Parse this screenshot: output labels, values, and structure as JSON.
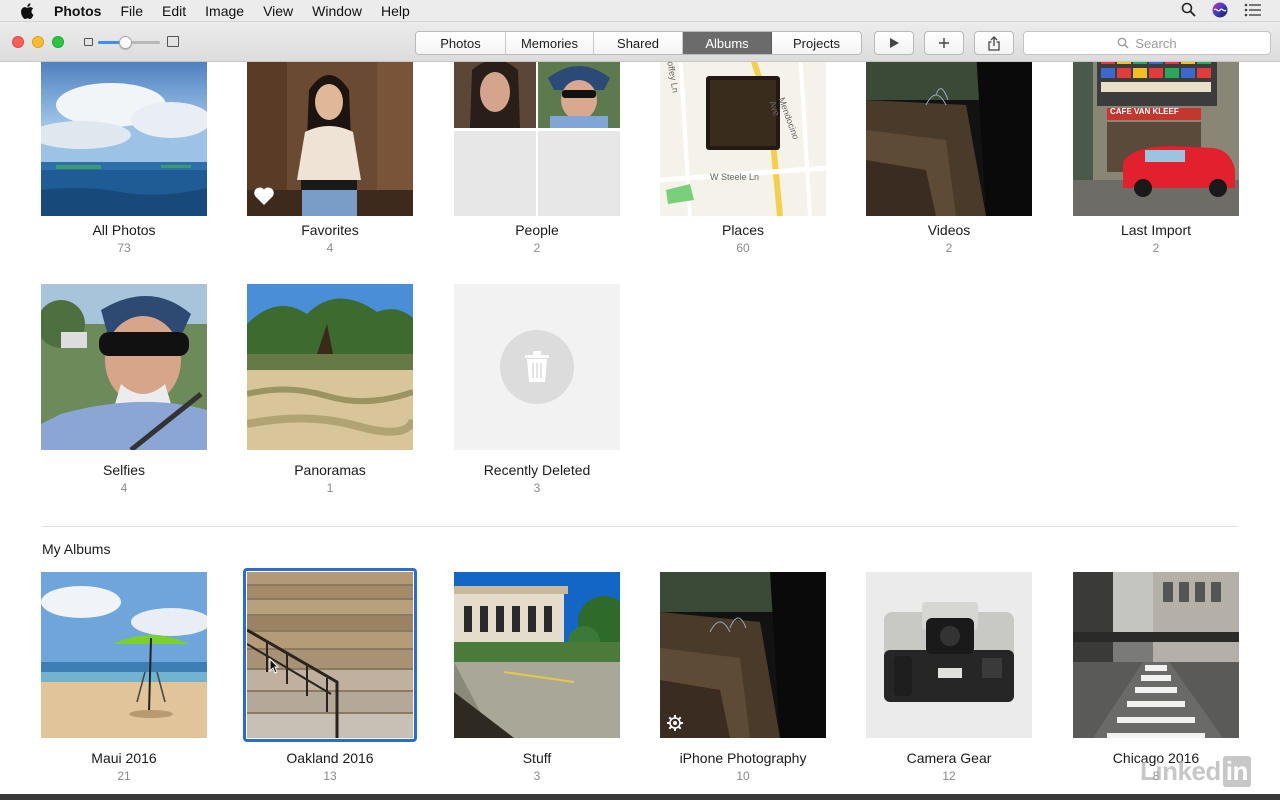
{
  "menubar": {
    "app_name": "Photos",
    "items": [
      "File",
      "Edit",
      "Image",
      "View",
      "Window",
      "Help"
    ]
  },
  "toolbar": {
    "zoom_level": 0.45,
    "tabs": [
      {
        "label": "Photos",
        "active": false
      },
      {
        "label": "Memories",
        "active": false
      },
      {
        "label": "Shared",
        "active": false
      },
      {
        "label": "Albums",
        "active": true
      },
      {
        "label": "Projects",
        "active": false
      }
    ],
    "search_placeholder": "Search"
  },
  "albums": [
    {
      "title": "All Photos",
      "count": "73"
    },
    {
      "title": "Favorites",
      "count": "4"
    },
    {
      "title": "People",
      "count": "2"
    },
    {
      "title": "Places",
      "count": "60"
    },
    {
      "title": "Videos",
      "count": "2"
    },
    {
      "title": "Last Import",
      "count": "2"
    },
    {
      "title": "Selfies",
      "count": "4"
    },
    {
      "title": "Panoramas",
      "count": "1"
    },
    {
      "title": "Recently Deleted",
      "count": "3"
    }
  ],
  "places_map": {
    "street1": "W Steele Ln",
    "street2": "Mendocino Ave",
    "street3": "Coffey Ln"
  },
  "storefront_sign": "CAFE VAN KLEEF",
  "my_albums": {
    "heading": "My Albums",
    "items": [
      {
        "title": "Maui 2016",
        "count": "21"
      },
      {
        "title": "Oakland 2016",
        "count": "13",
        "selected": true
      },
      {
        "title": "Stuff",
        "count": "3"
      },
      {
        "title": "iPhone Photography",
        "count": "10"
      },
      {
        "title": "Camera Gear",
        "count": "12"
      },
      {
        "title": "Chicago 2016",
        "count": "8"
      }
    ]
  },
  "watermark": {
    "text": "Linked",
    "badge": "in"
  },
  "colors": {
    "accent": "#2a6bd6",
    "active_tab": "#6b6b6b"
  }
}
